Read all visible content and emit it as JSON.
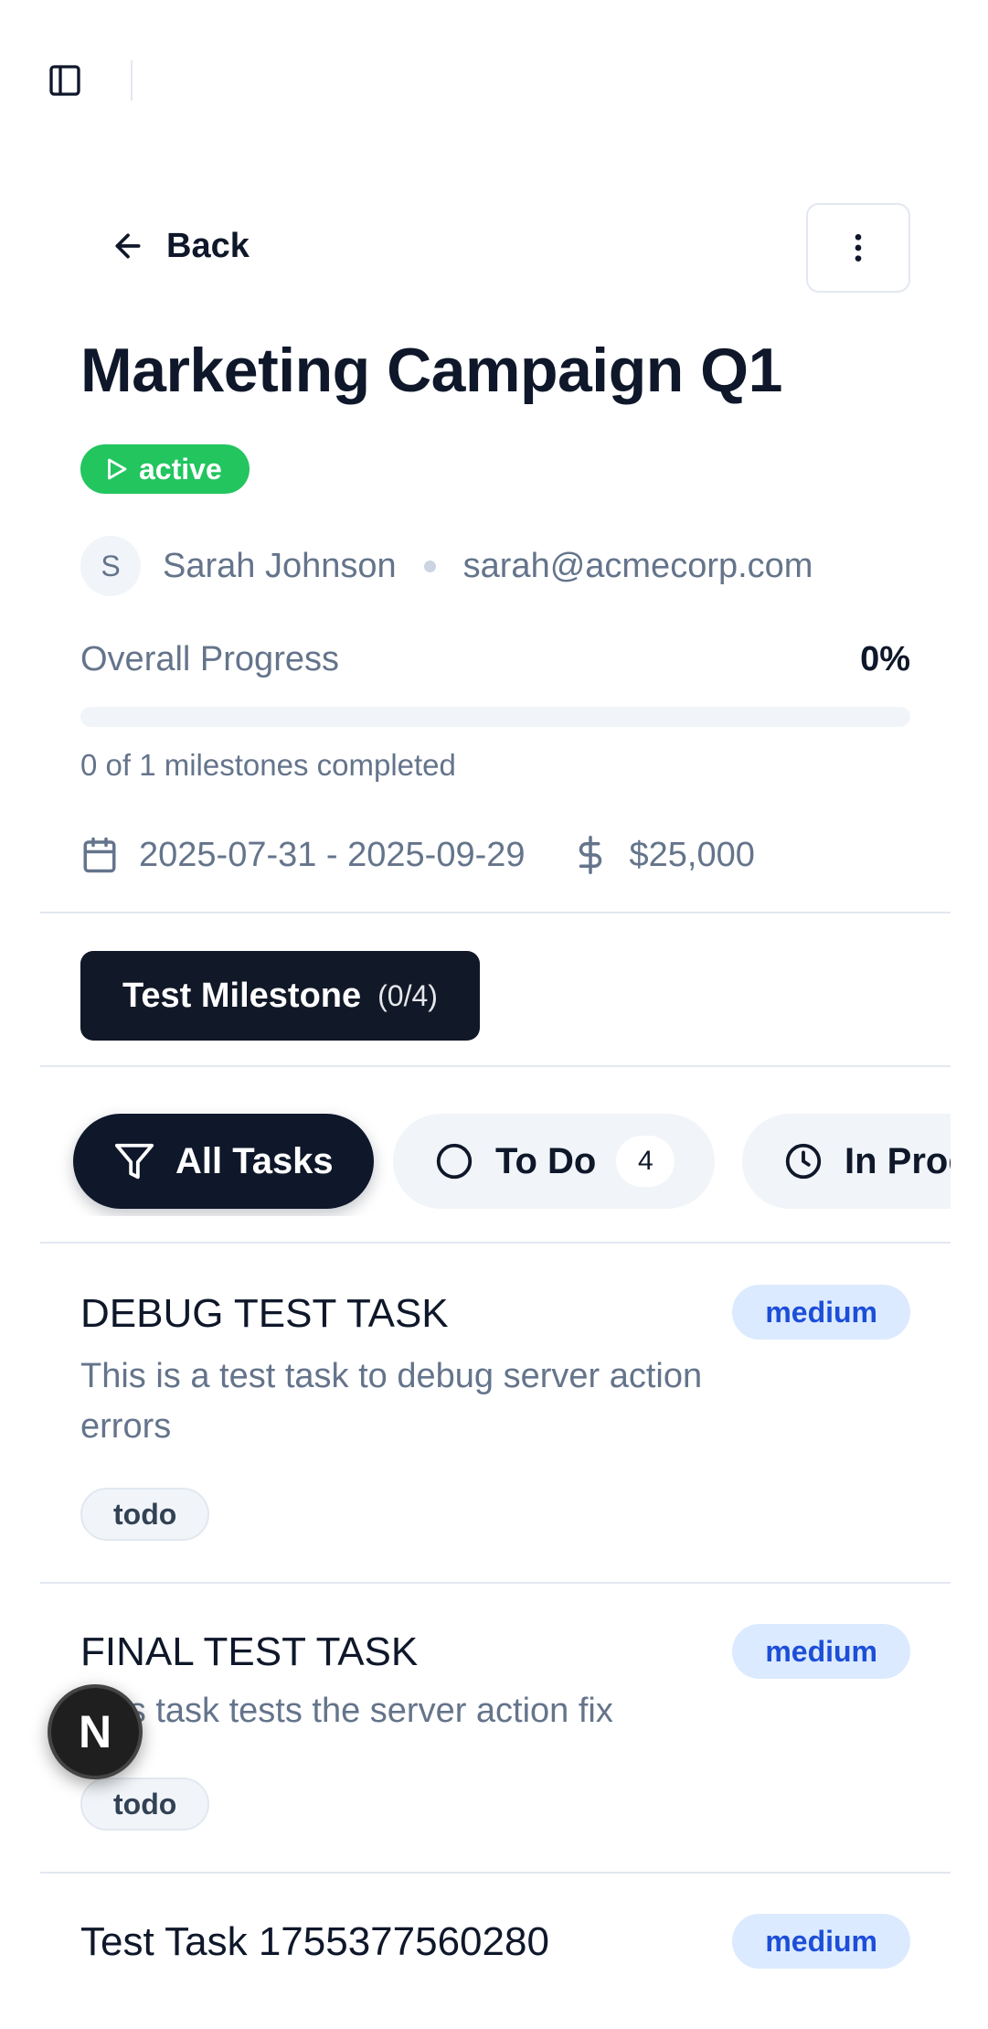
{
  "header": {
    "sidebar_toggle_icon": "sidebar-panel-icon"
  },
  "nav": {
    "back_label": "Back",
    "more_icon": "vertical-dots-icon"
  },
  "project": {
    "title": "Marketing Campaign Q1",
    "status": "active",
    "owner_initial": "S",
    "owner_name": "Sarah Johnson",
    "owner_email": "sarah@acmecorp.com",
    "progress_label": "Overall Progress",
    "progress_text": "0%",
    "progress_fraction": 0,
    "milestones_summary": "0 of 1 milestones completed",
    "date_range": "2025-07-31 - 2025-09-29",
    "budget": "$25,000"
  },
  "milestones": [
    {
      "label": "Test Milestone",
      "count": "(0/4)"
    }
  ],
  "filters": [
    {
      "label": "All Tasks",
      "icon": "filter-icon"
    },
    {
      "label": "To Do",
      "count": "4",
      "icon": "circle-icon"
    },
    {
      "label": "In Progress",
      "icon": "clock-icon"
    }
  ],
  "tasks": [
    {
      "title": "DEBUG TEST TASK",
      "description": "This is a test task to debug server action errors",
      "priority": "medium",
      "status": "todo"
    },
    {
      "title": "FINAL TEST TASK",
      "description": "This task tests the server action fix",
      "priority": "medium",
      "status": "todo"
    },
    {
      "title": "Test Task 1755377560280",
      "priority": "medium"
    }
  ],
  "dev_overlay": {
    "label": "N"
  },
  "colors": {
    "active": "#22c55e",
    "primary": "#0f172a",
    "priority_bg": "#dbeafe",
    "priority_text": "#1d4ed8"
  }
}
